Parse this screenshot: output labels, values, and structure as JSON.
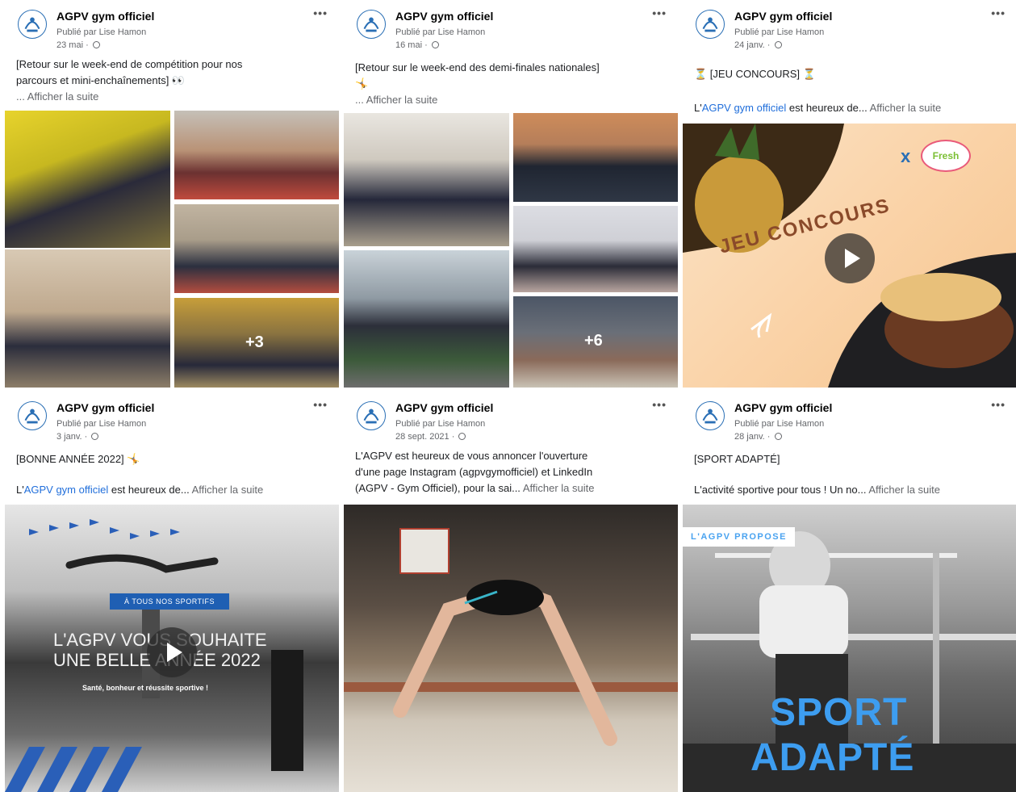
{
  "page_name": "AGPV gym officiel",
  "posts": [
    {
      "author": "AGPV gym officiel",
      "publisher": "Publié par Lise Hamon",
      "date": "23 mai ·",
      "text_1": "[Retour sur le week-end de compétition pour nos",
      "text_2": "parcours et mini-enchaînements] 👀",
      "see_more": "... Afficher la suite",
      "extra_count": "+3"
    },
    {
      "author": "AGPV gym officiel",
      "publisher": "Publié par Lise Hamon",
      "date": "16 mai ·",
      "text_1": "[Retour sur le week-end des demi-finales nationales]",
      "text_2": "🤸",
      "see_more": "... Afficher la suite",
      "extra_count": "+6"
    },
    {
      "author": "AGPV gym officiel",
      "publisher": "Publié par Lise Hamon",
      "date": "24 janv. ·",
      "text_1": "⏳ [JEU CONCOURS] ⏳",
      "text_pre": "L'",
      "text_link": "AGPV gym officiel",
      "text_post": " est heureux de...",
      "see_more": " Afficher la suite",
      "image_logo_x": "x",
      "image_brand": "Fresh",
      "image_headline": "JEU CONCOURS"
    },
    {
      "author": "AGPV gym officiel",
      "publisher": "Publié par Lise Hamon",
      "date": "3 janv. ·",
      "text_1": "[BONNE ANNÉE 2022] 🤸",
      "text_pre": "L'",
      "text_link": "AGPV gym officiel",
      "text_post": " est heureux de...",
      "see_more": " Afficher la suite",
      "image_banner": "À TOUS NOS SPORTIFS",
      "image_line1": "L'AGPV VOUS SOUHAITE",
      "image_line2": "UNE BELLE ANNÉE 2022",
      "image_sub": "Santé, bonheur et réussite sportive !"
    },
    {
      "author": "AGPV gym officiel",
      "publisher": "Publié par Lise Hamon",
      "date": "28 sept. 2021 ·",
      "text_1": "L'AGPV est heureux de vous annoncer l'ouverture",
      "text_2": "d'une page Instagram (agpvgymofficiel) et LinkedIn",
      "text_3": "(AGPV - Gym Officiel), pour la sai...",
      "see_more": " Afficher la suite"
    },
    {
      "author": "AGPV gym officiel",
      "publisher": "Publié par Lise Hamon",
      "date": "28 janv. ·",
      "text_1": "[SPORT ADAPTÉ]",
      "text_2": "L'activité sportive pour tous ! Un no...",
      "see_more": " Afficher la suite",
      "image_banner": "L'AGPV PROPOSE",
      "image_line1": "SPORT",
      "image_line2": "ADAPTÉ"
    }
  ],
  "colors": {
    "link": "#216fdb",
    "accent_blue": "#2a6fb5",
    "muted": "#65676b"
  },
  "icons": [
    "agpv-logo-icon",
    "more-options-icon",
    "globe-icon",
    "play-icon"
  ]
}
